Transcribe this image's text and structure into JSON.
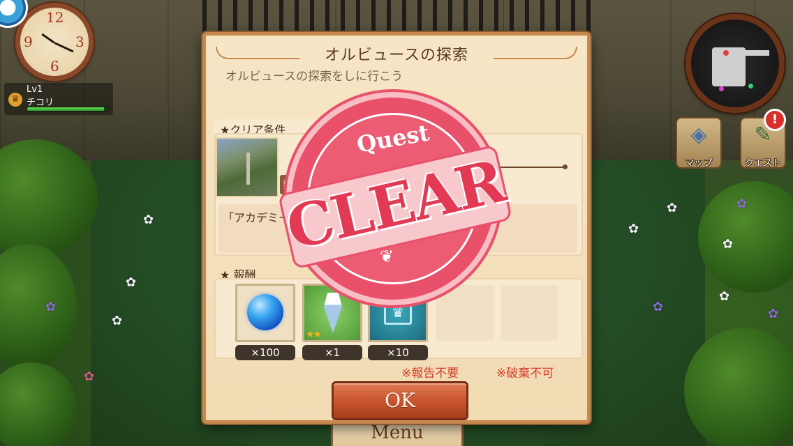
{
  "hud": {
    "clock": {
      "n12": "12",
      "n3": "3",
      "n6": "6",
      "n9": "9"
    },
    "player": {
      "level": "Lv1",
      "name": "チコリ",
      "hp_fraction": 0.95
    },
    "buttons": {
      "map_label": "マップ",
      "quest_label": "クエスト",
      "alert": "!"
    },
    "menu_label": "Menu"
  },
  "dialog": {
    "title": "オルビュースの探索",
    "subtitle": "オルビュースの探索をしに行こう",
    "clear_conditions_label": "★クリア条件",
    "condition": {
      "tag": "要请",
      "description": "「アカデミー"
    },
    "rewards_label": "★ 報酬",
    "rewards": [
      {
        "name": "blue-orb",
        "count": "×100"
      },
      {
        "name": "potion",
        "count": "×1",
        "stars": "★★"
      },
      {
        "name": "crown-card",
        "count": "×10"
      }
    ],
    "notes": {
      "no_report": "※報告不要",
      "no_discard": "※破棄不可"
    },
    "ok_label": "OK"
  },
  "stamp": {
    "top": "Quest",
    "main": "CLEAR"
  },
  "colors": {
    "accent": "#c8894e",
    "stamp": "#e9506a",
    "note": "#d33a2a",
    "ok": "#c9552f"
  }
}
